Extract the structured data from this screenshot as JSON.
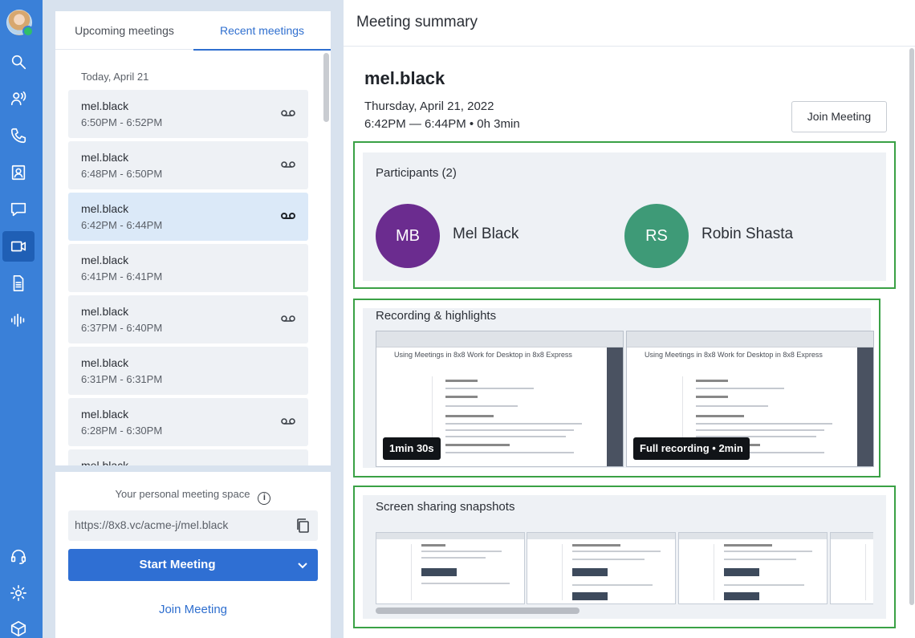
{
  "rail": {
    "items": [
      {
        "name": "search-icon",
        "active": false
      },
      {
        "name": "contacts-icon",
        "active": false
      },
      {
        "name": "phone-icon",
        "active": false
      },
      {
        "name": "directory-icon",
        "active": false
      },
      {
        "name": "chat-icon",
        "active": false
      },
      {
        "name": "video-icon",
        "active": true
      },
      {
        "name": "document-icon",
        "active": false
      },
      {
        "name": "voicemail-wave-icon",
        "active": false
      },
      {
        "name": "headset-icon",
        "active": false
      },
      {
        "name": "settings-icon",
        "active": false
      },
      {
        "name": "box-icon",
        "active": false
      }
    ]
  },
  "tabs": {
    "upcoming": "Upcoming meetings",
    "recent": "Recent meetings"
  },
  "meetings": {
    "day_label": "Today, April 21",
    "items": [
      {
        "name": "mel.black",
        "time": "6:50PM - 6:52PM",
        "recording": true
      },
      {
        "name": "mel.black",
        "time": "6:48PM - 6:50PM",
        "recording": true
      },
      {
        "name": "mel.black",
        "time": "6:42PM - 6:44PM",
        "recording": true,
        "selected": true
      },
      {
        "name": "mel.black",
        "time": "6:41PM - 6:41PM",
        "recording": false
      },
      {
        "name": "mel.black",
        "time": "6:37PM - 6:40PM",
        "recording": true
      },
      {
        "name": "mel.black",
        "time": "6:31PM - 6:31PM",
        "recording": false
      },
      {
        "name": "mel.black",
        "time": "6:28PM - 6:30PM",
        "recording": true
      },
      {
        "name": "mel.black",
        "time": "",
        "recording": false
      }
    ]
  },
  "personal_space": {
    "label": "Your personal meeting space",
    "link": "https://8x8.vc/acme-j/mel.black",
    "start_label": "Start Meeting",
    "join_label": "Join Meeting"
  },
  "summary": {
    "header": "Meeting summary",
    "title": "mel.black",
    "date": "Thursday, April 21, 2022",
    "time": "6:42PM — 6:44PM • 0h 3min",
    "join_label": "Join Meeting",
    "participants_title": "Participants (2)",
    "participants": [
      {
        "initials": "MB",
        "name": "Mel Black",
        "color": "#6b2c8f"
      },
      {
        "initials": "RS",
        "name": "Robin Shasta",
        "color": "#3e9a77"
      }
    ],
    "recording_title": "Recording & highlights",
    "recordings": [
      {
        "badge": "1min 30s",
        "doc_title": "Using Meetings in 8x8 Work for Desktop in 8x8 Express"
      },
      {
        "badge": "Full recording • 2min",
        "doc_title": "Using Meetings in 8x8 Work for Desktop in 8x8 Express"
      }
    ],
    "snapshots_title": "Screen sharing snapshots"
  }
}
